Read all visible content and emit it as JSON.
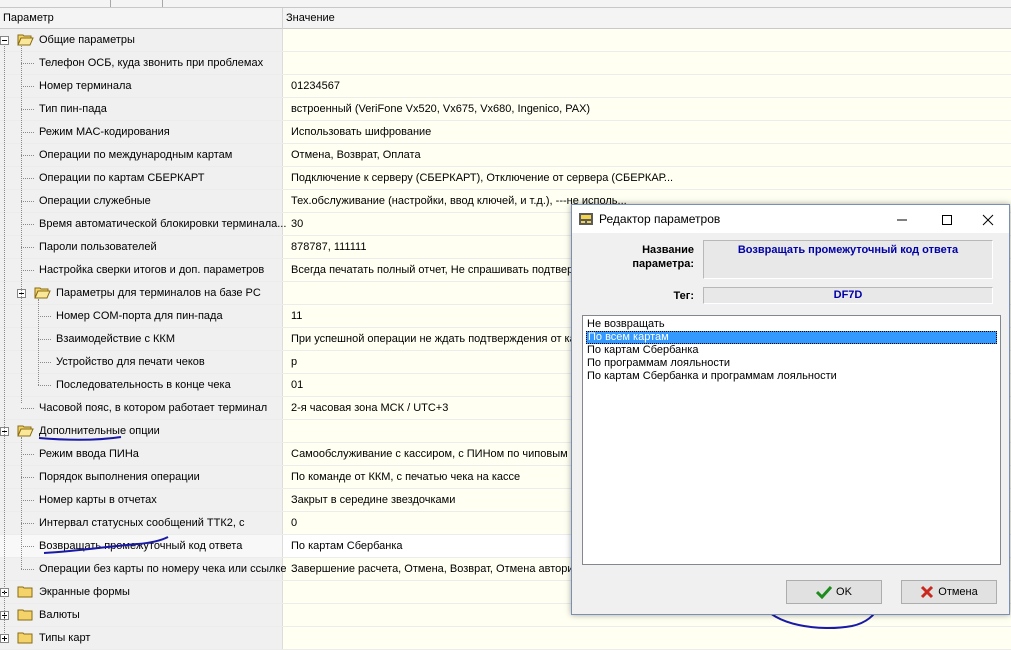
{
  "header": {
    "col_param": "Параметр",
    "col_value": "Значение"
  },
  "rows": [
    {
      "label": "Общие параметры",
      "value": ""
    },
    {
      "label": "Телефон ОСБ, куда звонить при проблемах",
      "value": ""
    },
    {
      "label": "Номер терминала",
      "value": "01234567"
    },
    {
      "label": "Тип пин-пада",
      "value": "встроенный (VeriFone Vx520, Vx675, Vx680, Ingenico, PAX)"
    },
    {
      "label": "Режим MAC-кодирования",
      "value": "Использовать шифрование"
    },
    {
      "label": "Операции по международным картам",
      "value": "Отмена, Возврат, Оплата"
    },
    {
      "label": "Операции по картам СБЕРКАРТ",
      "value": "Подключение к серверу (СБЕРКАРТ), Отключение от сервера (СБЕРКАР..."
    },
    {
      "label": "Операции служебные",
      "value": "Тех.обслуживание (настройки, ввод ключей, и т.д.), ---не исполь..."
    },
    {
      "label": "Время автоматической блокировки терминала...",
      "value": "30"
    },
    {
      "label": "Пароли пользователей",
      "value": "878787, 111111"
    },
    {
      "label": "Настройка сверки итогов и доп. параметров",
      "value": "Всегда печатать полный отчет, Не спрашивать подтвержд..."
    },
    {
      "label": "Параметры для терминалов на базе PC",
      "value": ""
    },
    {
      "label": "Номер COM-порта для пин-пада",
      "value": "11"
    },
    {
      "label": "Взаимодействие с ККМ",
      "value": "При успешной операции не ждать подтверждения от касс..."
    },
    {
      "label": "Устройство для печати чеков",
      "value": "p"
    },
    {
      "label": "Последовательность в конце чека",
      "value": "01"
    },
    {
      "label": "Часовой пояс, в котором работает терминал",
      "value": "2-я часовая зона МСК / UTC+3"
    },
    {
      "label": "Дополнительные опции",
      "value": ""
    },
    {
      "label": "Режим ввода ПИНа",
      "value": "Самообслуживание с кассиром, с ПИНом по чиповым кар..."
    },
    {
      "label": "Порядок выполнения операции",
      "value": "По команде от ККМ, с печатью чека на кассе"
    },
    {
      "label": "Номер карты в отчетах",
      "value": "Закрыт в середине звездочками"
    },
    {
      "label": "Интервал статусных сообщений ТТК2, с",
      "value": "0"
    },
    {
      "label": "Возвращать промежуточный код ответа",
      "value": "По картам Сбербанка"
    },
    {
      "label": "Операции без карты по номеру чека или ссылке",
      "value": "Завершение расчета, Отмена, Возврат, Отмена авториза..."
    },
    {
      "label": "Экранные формы",
      "value": ""
    },
    {
      "label": "Валюты",
      "value": ""
    },
    {
      "label": "Типы карт",
      "value": ""
    }
  ],
  "dialog": {
    "title": "Редактор параметров",
    "minimize_icon": "minimize-icon",
    "maximize_icon": "maximize-icon",
    "close_icon": "close-icon",
    "name_label": "Название параметра:",
    "name_value": "Возвращать промежуточный код ответа",
    "tag_label": "Тег:",
    "tag_value": "DF7D",
    "options": [
      "Не возвращать",
      "По всем картам",
      "По картам Сбербанка",
      "По программам лояльности",
      "По картам Сбербанка и программам лояльности"
    ],
    "selected_option": "По всем картам",
    "ok_label": "OK",
    "cancel_label": "Отмена"
  },
  "colors": {
    "value_bg": "#fffff2",
    "label_bg": "#f0f0f0",
    "selection": "#3399ff",
    "field_text": "#0000a8",
    "annotation": "#1a1aa8"
  }
}
